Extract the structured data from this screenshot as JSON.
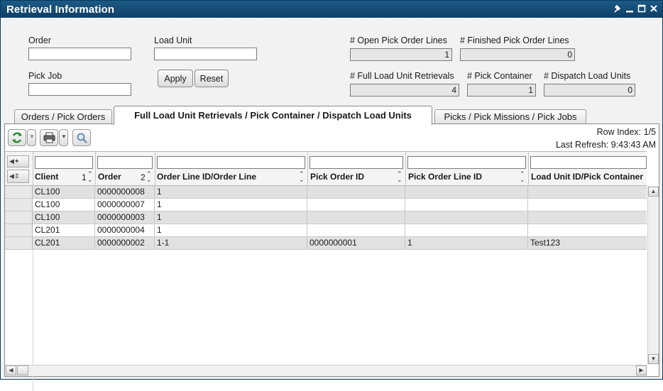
{
  "window": {
    "title": "Retrieval Information",
    "controls": [
      "pin-icon",
      "minimize-icon",
      "maximize-icon",
      "close-icon"
    ]
  },
  "form": {
    "order_label": "Order",
    "order_value": "",
    "load_unit_label": "Load Unit",
    "load_unit_value": "",
    "pick_job_label": "Pick Job",
    "pick_job_value": "",
    "apply_label": "Apply",
    "reset_label": "Reset"
  },
  "stats": {
    "open_pick_order_lines_label": "# Open Pick Order Lines",
    "open_pick_order_lines_value": "1",
    "finished_pick_order_lines_label": "# Finished Pick Order Lines",
    "finished_pick_order_lines_value": "0",
    "full_load_unit_retrievals_label": "# Full Load Unit Retrievals",
    "full_load_unit_retrievals_value": "4",
    "pick_container_label": "# Pick Container",
    "pick_container_value": "1",
    "dispatch_load_units_label": "# Dispatch Load Units",
    "dispatch_load_units_value": "0"
  },
  "tabs": [
    {
      "label": "Orders / Pick Orders",
      "active": false
    },
    {
      "label": "Full Load Unit Retrievals / Pick Container / Dispatch Load Units",
      "active": true
    },
    {
      "label": "Picks / Pick Missions / Pick Jobs",
      "active": false
    }
  ],
  "toolbar": {
    "icons": [
      "refresh-icon",
      "dropdown-icon",
      "print-icon",
      "dropdown-icon",
      "search-icon"
    ],
    "row_index": "Row Index: 1/5",
    "last_refresh": "Last Refresh: 9:43:43 AM"
  },
  "table": {
    "columns": [
      {
        "label": "Client",
        "sort": "1"
      },
      {
        "label": "Order",
        "sort": "2"
      },
      {
        "label": "Order Line ID/Order Line",
        "sort": ""
      },
      {
        "label": "Pick Order ID",
        "sort": ""
      },
      {
        "label": "Pick Order Line ID",
        "sort": ""
      },
      {
        "label": "Load Unit ID/Pick Container",
        "sort": ""
      }
    ],
    "rows": [
      [
        "CL100",
        "0000000008",
        "1",
        "",
        "",
        ""
      ],
      [
        "CL100",
        "0000000007",
        "1",
        "",
        "",
        ""
      ],
      [
        "CL100",
        "0000000003",
        "1",
        "",
        "",
        ""
      ],
      [
        "CL201",
        "0000000004",
        "1",
        "",
        "",
        ""
      ],
      [
        "CL201",
        "0000000002",
        "1-1",
        "0000000001",
        "1",
        "Test123"
      ]
    ]
  }
}
